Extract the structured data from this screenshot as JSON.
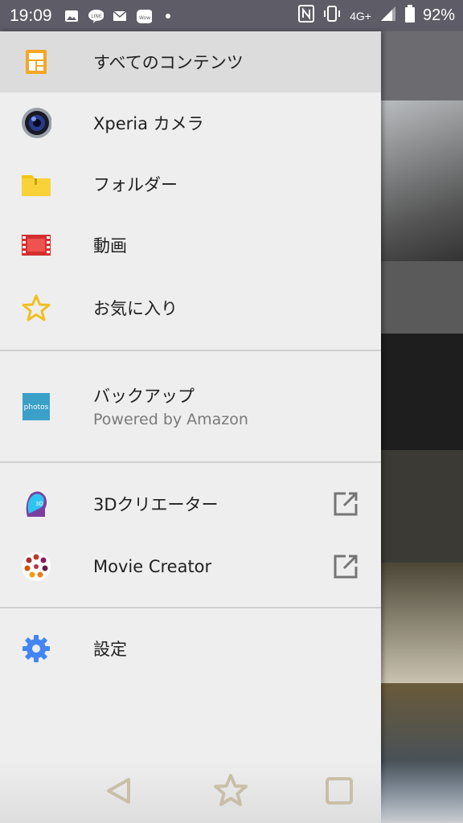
{
  "status_bar": {
    "time": "19:09",
    "network": "4G+",
    "battery": "92%",
    "icons": [
      "image-icon",
      "line-icon",
      "mail-icon",
      "wowma-icon",
      "dot-icon",
      "nfc-icon",
      "vibrate-icon",
      "signal-icon",
      "battery-icon"
    ]
  },
  "drawer": {
    "items": [
      {
        "label": "すべてのコンテンツ",
        "icon": "all-content-icon",
        "selected": true
      },
      {
        "label": "Xperia カメラ",
        "icon": "camera-icon"
      },
      {
        "label": "フォルダー",
        "icon": "folder-icon"
      },
      {
        "label": "動画",
        "icon": "film-icon"
      },
      {
        "label": "お気に入り",
        "icon": "star-icon"
      }
    ],
    "backup": {
      "label": "バックアップ",
      "sub": "Powered by Amazon",
      "icon_text": "photos"
    },
    "apps": [
      {
        "label": "3Dクリエーター",
        "icon": "3d-creator-icon",
        "external": true
      },
      {
        "label": "Movie Creator",
        "icon": "movie-creator-icon",
        "external": true
      }
    ],
    "settings": {
      "label": "設定",
      "icon": "gear-icon"
    }
  },
  "colors": {
    "accent_blue": "#4285f4",
    "folder_yellow": "#f5c518",
    "film_red": "#d32f2f",
    "star_yellow": "#f0c020",
    "status_bar": "#5e5c66"
  },
  "navigation": {
    "back": "back-icon",
    "home": "home-star-icon",
    "recents": "recents-icon"
  }
}
